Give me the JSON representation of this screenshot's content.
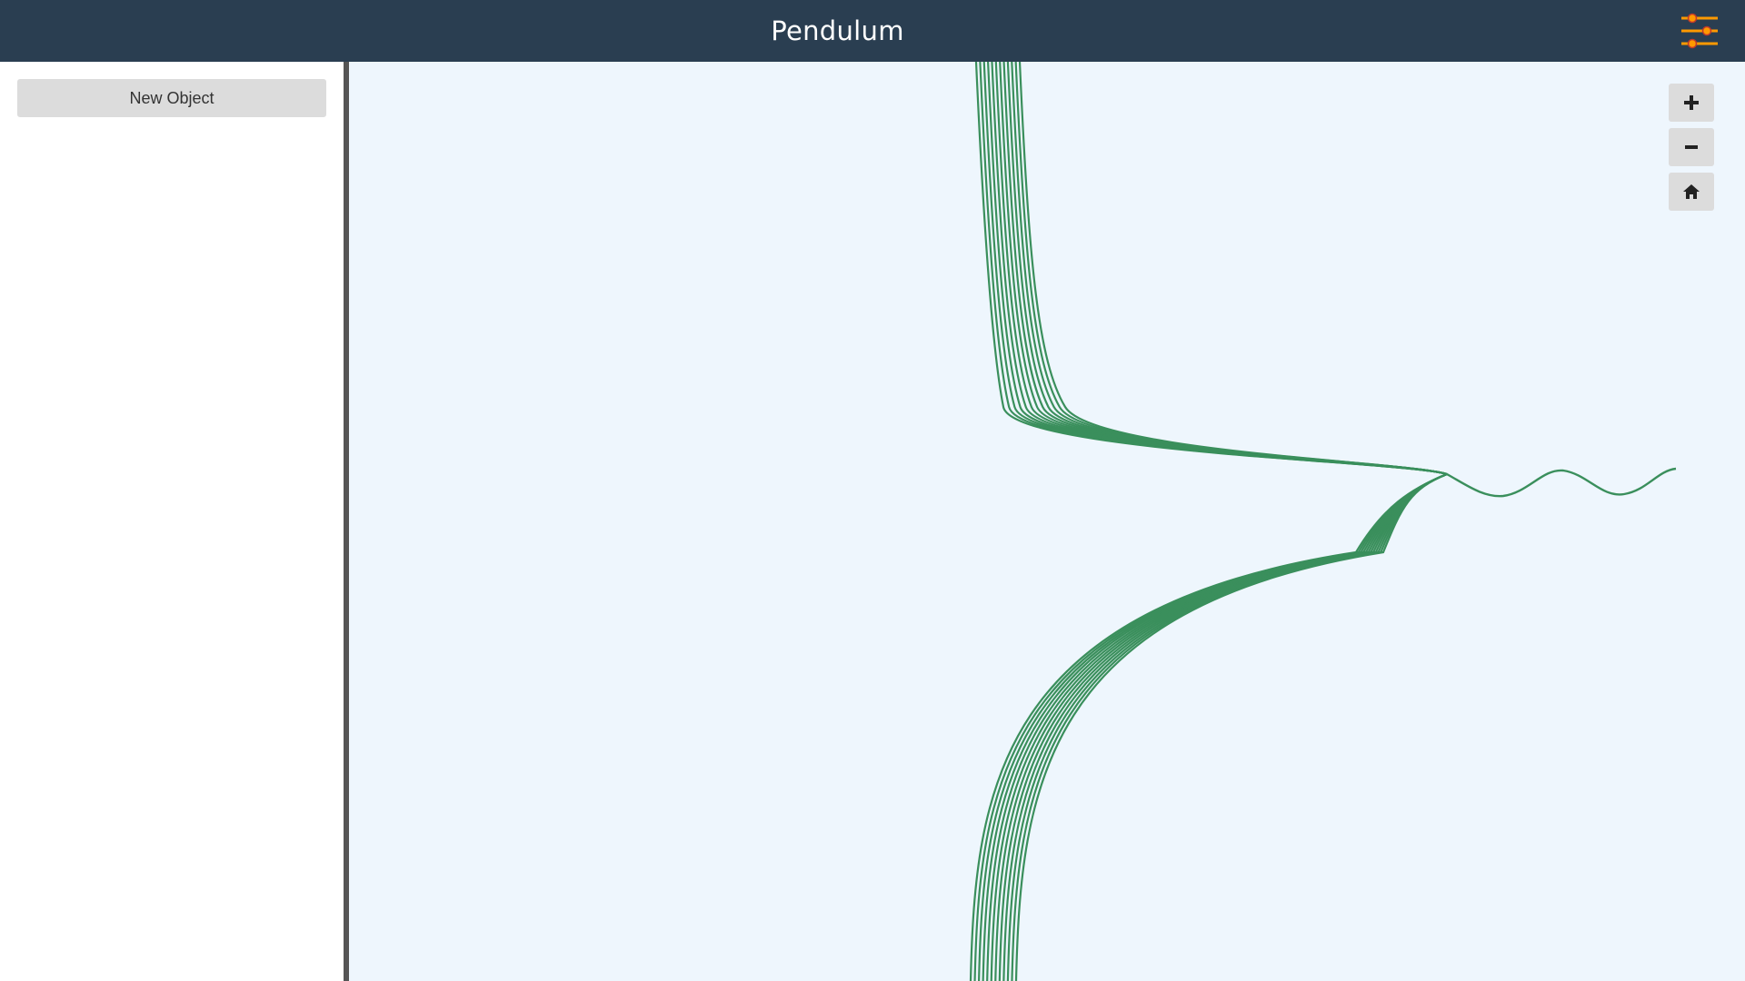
{
  "header": {
    "title": "Pendulum",
    "settings_icon": "sliders-icon",
    "settings_accent": "#ff9900",
    "background": "#2a3e51"
  },
  "sidebar": {
    "new_object_label": "New Object"
  },
  "canvas": {
    "background": "#eef6fd",
    "trace_color": "#3a8f5c",
    "controls": [
      {
        "name": "zoom-in",
        "icon": "plus-icon"
      },
      {
        "name": "zoom-out",
        "icon": "minus-icon"
      },
      {
        "name": "home",
        "icon": "home-icon"
      }
    ]
  }
}
